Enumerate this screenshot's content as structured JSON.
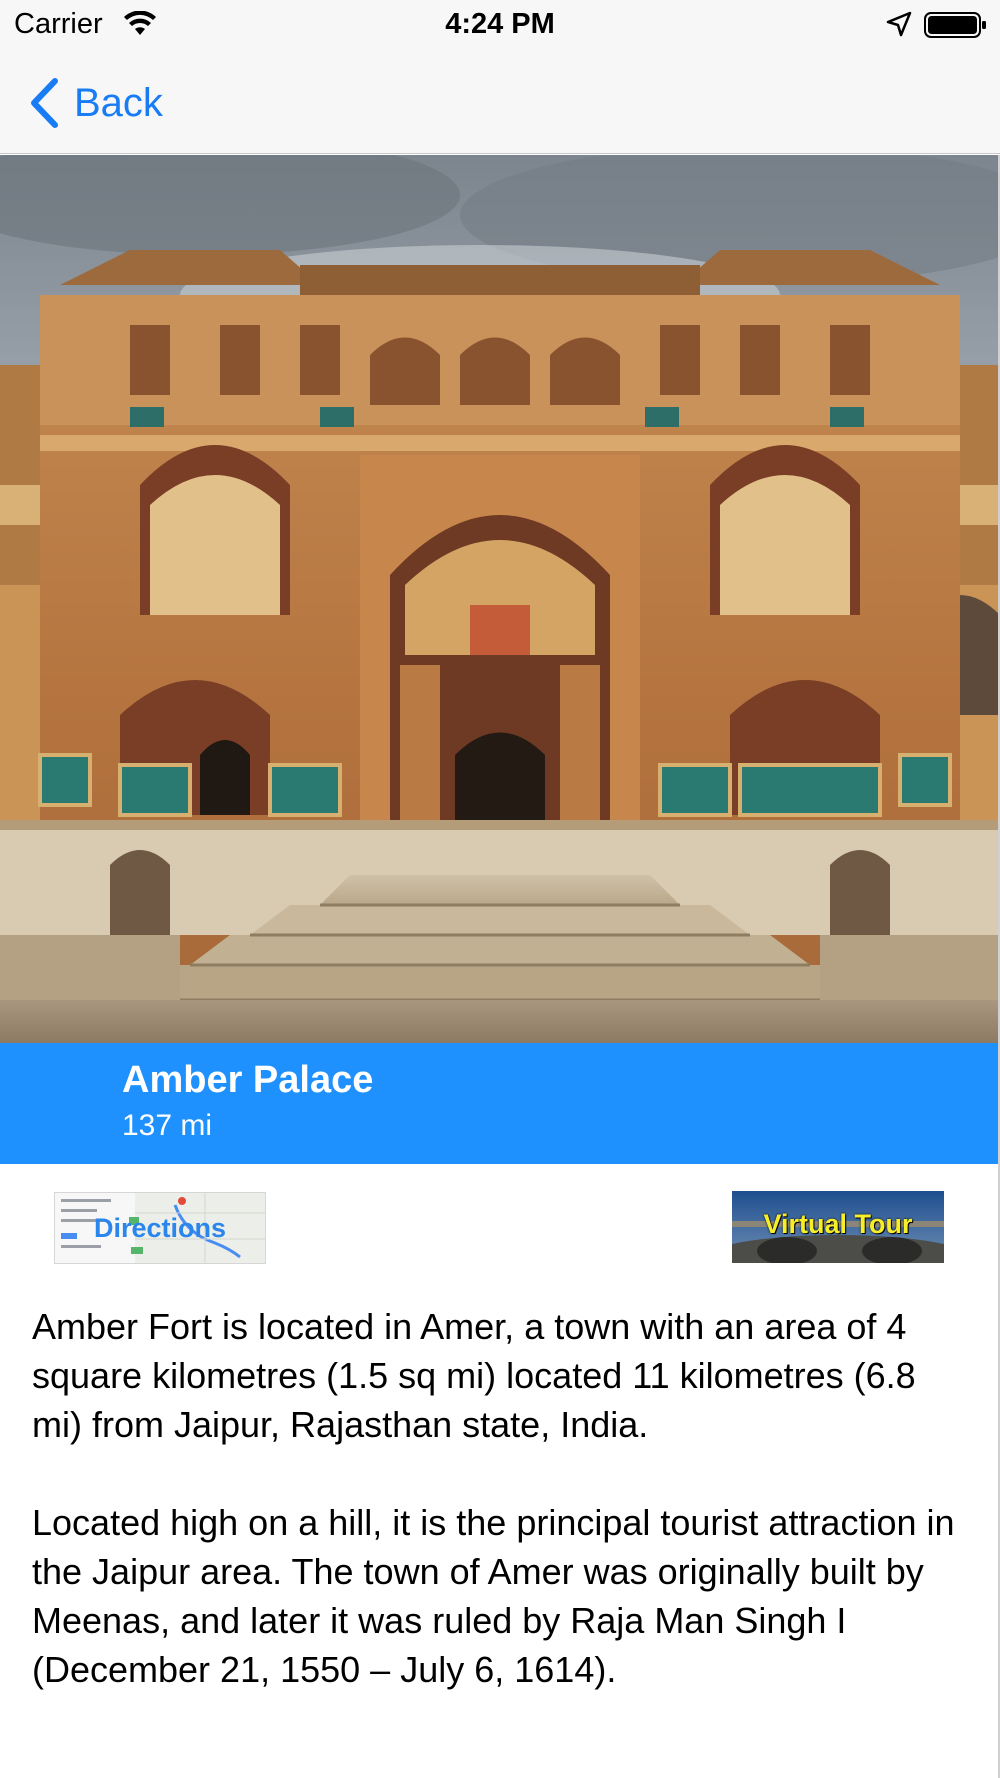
{
  "status_bar": {
    "carrier": "Carrier",
    "time": "4:24 PM",
    "icons": [
      "wifi-icon",
      "location-arrow-icon",
      "battery-icon"
    ]
  },
  "nav": {
    "back_label": "Back",
    "back_icon": "chevron-left-icon"
  },
  "place": {
    "name": "Amber Palace",
    "distance": "137 mi"
  },
  "actions": {
    "directions_label": "Directions",
    "virtual_tour_label": "Virtual Tour"
  },
  "description": {
    "paragraph_1": "Amber Fort is located in Amer, a town with an area of 4 square kilometres (1.5 sq mi) located 11 kilometres (6.8 mi) from Jaipur, Rajasthan state, India.",
    "paragraph_2": "Located high on a hill, it is the principal tourist attraction in the Jaipur area. The town of Amer was originally built by Meenas, and later it was ruled by Raja Man Singh I (December 21, 1550 – July 6, 1614)."
  },
  "colors": {
    "accent_blue": "#1a7cf5",
    "title_band": "#1e91ff",
    "tour_text": "#f7ee2a"
  }
}
